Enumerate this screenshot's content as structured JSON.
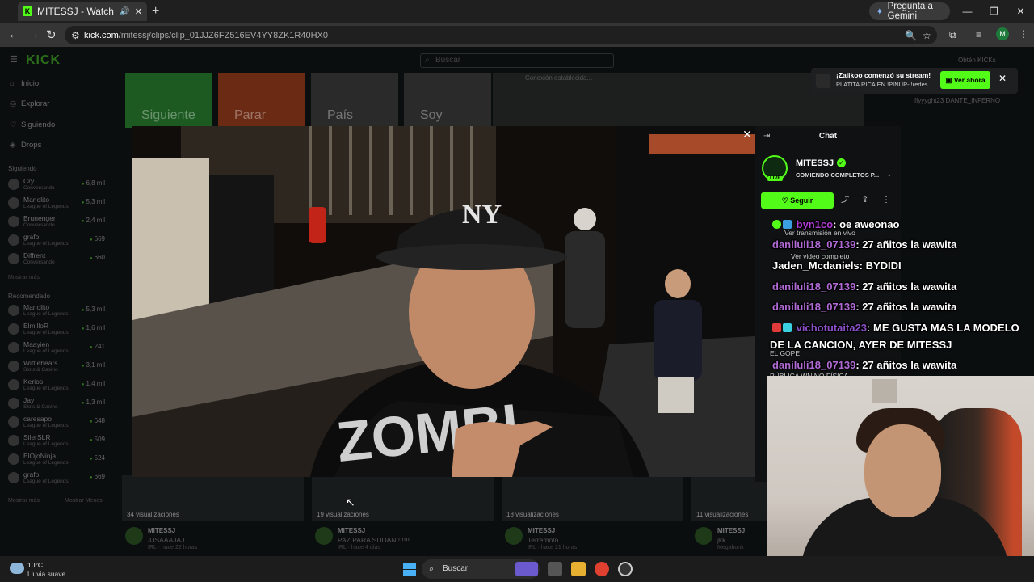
{
  "browser": {
    "tab_title": "MITESSJ - Watch clips on Ki",
    "new_tab": "+",
    "gemini_label": "Pregunta a Gemini",
    "url_host": "kick.com",
    "url_path": "/mitessj/clips/clip_01JJZ6FZ516EV4YY8ZK1R40HX0",
    "profile_initial": "M"
  },
  "kick": {
    "logo": "KICK",
    "search_placeholder": "Buscar",
    "nav": [
      "Inicio",
      "Explorar",
      "Siguiendo",
      "Drops"
    ],
    "following_header": "Siguiendo",
    "following": [
      {
        "name": "Cry",
        "game": "Conversando",
        "viewers": "6,8 mil"
      },
      {
        "name": "Manolito",
        "game": "League of Legends",
        "viewers": "5,3 mil"
      },
      {
        "name": "Brunenger",
        "game": "Conversando",
        "viewers": "2,4 mil"
      },
      {
        "name": "grafo",
        "game": "League of Legends",
        "viewers": "669"
      },
      {
        "name": "Diffrent",
        "game": "Conversando",
        "viewers": "660"
      }
    ],
    "show_more": "Mostrar más",
    "recommended_header": "Recomendado",
    "recommended": [
      {
        "name": "Manolito",
        "game": "League of Legends",
        "viewers": "5,3 mil"
      },
      {
        "name": "ElmilloR",
        "game": "League of Legends",
        "viewers": "1,6 mil"
      },
      {
        "name": "Maayien",
        "game": "League of Legends",
        "viewers": "241"
      },
      {
        "name": "Wittlebears",
        "game": "Slots & Casino",
        "viewers": "3,1 mil"
      },
      {
        "name": "Kerios",
        "game": "League of Legends",
        "viewers": "1,4 mil"
      },
      {
        "name": "Jay",
        "game": "Slots & Casino",
        "viewers": "1,3 mil"
      },
      {
        "name": "caresapo",
        "game": "League of Legends",
        "viewers": "648"
      },
      {
        "name": "SilerSLR",
        "game": "League of Legends",
        "viewers": "509"
      },
      {
        "name": "ElOjoNinja",
        "game": "League of Legends",
        "viewers": "524"
      },
      {
        "name": "grafo",
        "game": "League of Legends",
        "viewers": "669"
      }
    ],
    "show_more_2": "Mostrar más",
    "show_less": "Mostrar Menos",
    "banner_items": [
      "Siguiente",
      "Parar",
      "País",
      "Soy"
    ],
    "banner_panel": "Conexión establecida...",
    "top_right": "Obtén KICKs",
    "viewer_names": "ffyyyght23   DANTE_INFERNO",
    "cards": [
      {
        "views": "34 visualizaciones",
        "channel": "MITESSJ",
        "title": "JJSAAAJAJ",
        "meta": "IRL · hace 22 horas"
      },
      {
        "views": "19 visualizaciones",
        "channel": "MITESSJ",
        "title": "PAZ PARA SUDAN!!!!!!!",
        "meta": "IRL · hace 4 días"
      },
      {
        "views": "18 visualizaciones",
        "channel": "MITESSJ",
        "title": "Terremoto",
        "meta": "IRL · hace 21 horas"
      },
      {
        "views": "11 visualizaciones",
        "channel": "MITESSJ",
        "title": "jkk",
        "meta": "Megabonk"
      }
    ]
  },
  "modal": {
    "close": "✕"
  },
  "chat": {
    "header": "Chat",
    "streamer": "MITESSJ",
    "live_badge": "LIVE",
    "stream_title": "COMIENDO COMPLETOS P...",
    "follow_label": "Seguir",
    "messages": [
      {
        "user": "byn1co",
        "text": ": oe aweonao"
      },
      {
        "user": "daniluli18_07139",
        "text": ": 27 añitos la wawita"
      },
      {
        "user": "Jaden_Mcdaniels",
        "text": ": BYDIDI"
      },
      {
        "user": "daniluli18_07139",
        "text": ": 27 añitos la wawita"
      },
      {
        "user": "daniluli18_07139",
        "text": ": 27 añitos la wawita"
      },
      {
        "user": "vichotutaita23",
        "text": ": ME GUSTA MAS LA MODELO"
      },
      {
        "user": "",
        "text": "DE LA CANCION, AYER DE MITESSJ"
      },
      {
        "user": "daniluli18_07139",
        "text": ": 27 añitos la wawita"
      }
    ],
    "sub_lines": [
      "Ver transmisión en vivo",
      "Ver video completo",
      "EL GOPE",
      "PÚBLICA WN NO FÍSICA"
    ]
  },
  "toast": {
    "title": "¡Zaiikoo comenzó su stream!",
    "subtitle": "PLATITA RICA EN !PINUP- !redes...",
    "button": "Ver ahora",
    "close": "✕"
  },
  "taskbar": {
    "temp": "10°C",
    "condition": "Lluvia suave",
    "search": "Buscar"
  },
  "colors": {
    "kick_green": "#53fc18",
    "username_purple": "#c86fe8"
  }
}
